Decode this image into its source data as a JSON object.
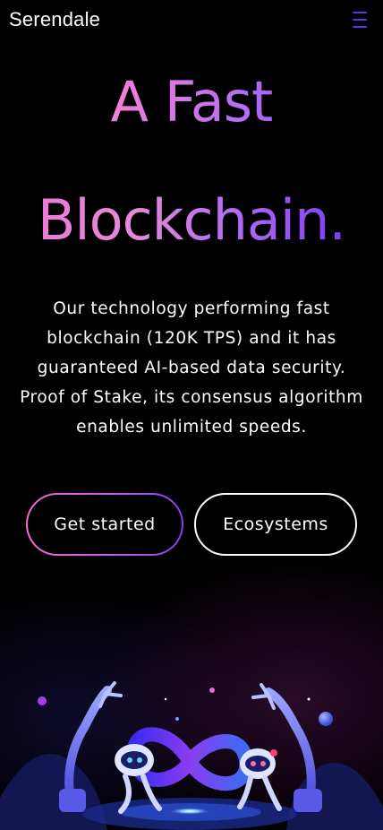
{
  "header": {
    "brand": "Serendale",
    "menu_icon": "hamburger-menu-icon"
  },
  "hero": {
    "title_line1": "A Fast",
    "title_line2": "Blockchain.",
    "description": "Our technology performing fast blockchain (120K TPS) and it has guaranteed AI-based data security. Proof of Stake, its consensus algorithm enables unlimited speeds."
  },
  "actions": {
    "primary_label": "Get started",
    "secondary_label": "Ecosystems"
  },
  "colors": {
    "accent": "#6a2cf5",
    "gradient_pink": "#f26bd3",
    "gradient_purple": "#6a2cf5",
    "background": "#000000"
  },
  "illustration": {
    "icon": "robots-infinity-illustration"
  }
}
